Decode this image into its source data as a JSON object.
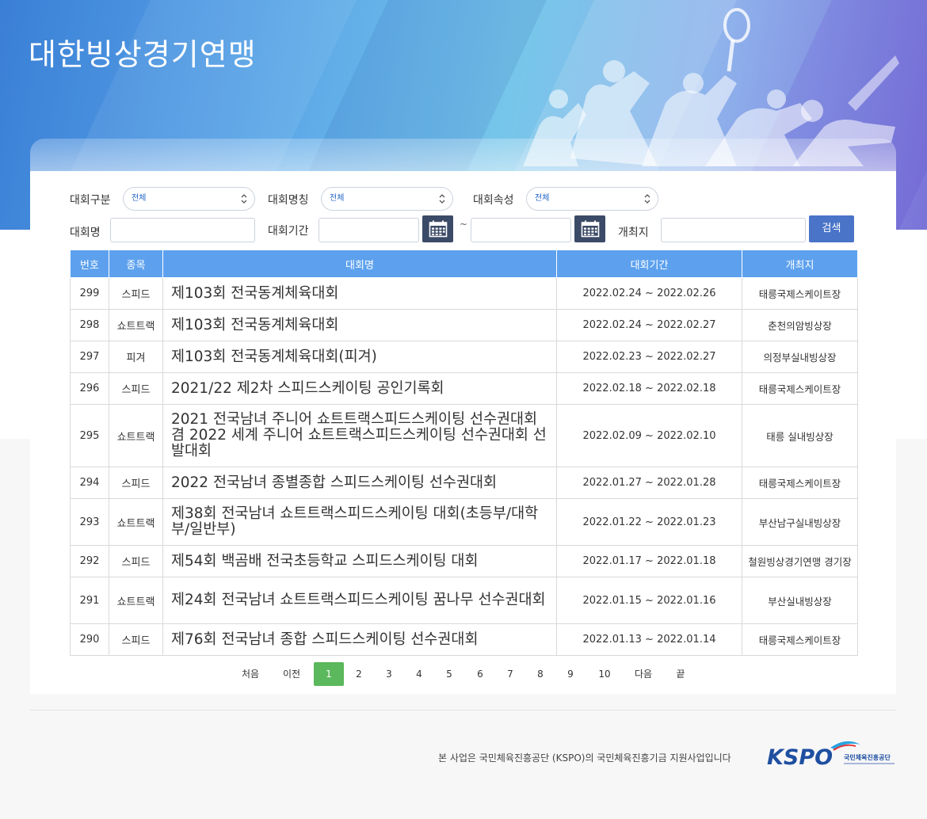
{
  "header": {
    "title": "대한빙상경기연맹"
  },
  "filters": {
    "category_label": "대회구분",
    "category_value": "전체",
    "name_type_label": "대회명칭",
    "name_type_value": "전체",
    "attr_label": "대회속성",
    "attr_value": "전체",
    "name_label": "대회명",
    "period_label": "대회기간",
    "period_separator": "~",
    "venue_label": "개최지",
    "search_button": "검색"
  },
  "table": {
    "headers": [
      "번호",
      "종목",
      "대회명",
      "대회기간",
      "개최지"
    ],
    "rows": [
      {
        "no": "299",
        "event": "스피드",
        "name": "제103회 전국동계체육대회",
        "period": "2022.02.24 ~ 2022.02.26",
        "venue": "태릉국제스케이트장"
      },
      {
        "no": "298",
        "event": "쇼트트랙",
        "name": "제103회 전국동계체육대회",
        "period": "2022.02.24 ~ 2022.02.27",
        "venue": "춘천의암빙상장"
      },
      {
        "no": "297",
        "event": "피겨",
        "name": "제103회 전국동계체육대회(피겨)",
        "period": "2022.02.23 ~ 2022.02.27",
        "venue": "의정부실내빙상장"
      },
      {
        "no": "296",
        "event": "스피드",
        "name": "2021/22 제2차 스피드스케이팅 공인기록회",
        "period": "2022.02.18 ~ 2022.02.18",
        "venue": "태릉국제스케이트장"
      },
      {
        "no": "295",
        "event": "쇼트트랙",
        "name": "2021 전국남녀 주니어 쇼트트랙스피드스케이팅 선수권대회 겸 2022 세계 주니어 쇼트트랙스피드스케이팅 선수권대회 선발대회",
        "period": "2022.02.09 ~ 2022.02.10",
        "venue": "태릉 실내빙상장"
      },
      {
        "no": "294",
        "event": "스피드",
        "name": "2022 전국남녀 종별종합 스피드스케이팅 선수권대회",
        "period": "2022.01.27 ~ 2022.01.28",
        "venue": "태릉국제스케이트장"
      },
      {
        "no": "293",
        "event": "쇼트트랙",
        "name": "제38회 전국남녀 쇼트트랙스피드스케이팅 대회(초등부/대학부/일반부)",
        "period": "2022.01.22 ~ 2022.01.23",
        "venue": "부산남구실내빙상장"
      },
      {
        "no": "292",
        "event": "스피드",
        "name": "제54회 백곰배 전국초등학교 스피드스케이팅 대회",
        "period": "2022.01.17 ~ 2022.01.18",
        "venue": "철원빙상경기연맹 경기장"
      },
      {
        "no": "291",
        "event": "쇼트트랙",
        "name": "제24회 전국남녀 쇼트트랙스피드스케이팅 꿈나무 선수권대회",
        "period": "2022.01.15 ~ 2022.01.16",
        "venue": "부산실내빙상장"
      },
      {
        "no": "290",
        "event": "스피드",
        "name": "제76회 전국남녀 종합 스피드스케이팅 선수권대회",
        "period": "2022.01.13 ~ 2022.01.14",
        "venue": "태릉국제스케이트장"
      }
    ]
  },
  "pagination": {
    "first": "처음",
    "prev": "이전",
    "pages": [
      "1",
      "2",
      "3",
      "4",
      "5",
      "6",
      "7",
      "8",
      "9",
      "10"
    ],
    "current": "1",
    "next": "다음",
    "last": "끝"
  },
  "footer": {
    "note": "본 사업은 국민체육진흥공단 (KSPO)의 국민체육진흥기금 지원사업입니다",
    "logo_text": "KSPO",
    "logo_sub": "국민체육진흥공단"
  },
  "colors": {
    "table_header": "#5da1ee",
    "search_button": "#4a74c8",
    "calendar_button": "#3b4a66",
    "active_page": "#5cb85c"
  }
}
